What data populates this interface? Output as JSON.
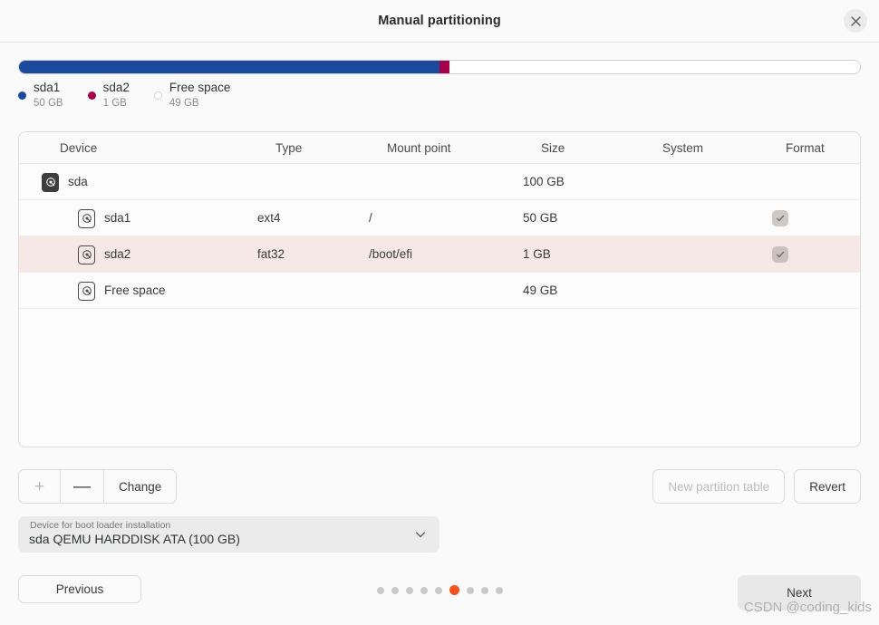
{
  "window": {
    "title": "Manual partitioning",
    "close_icon": "close-icon"
  },
  "usage": {
    "segments": [
      {
        "name": "sda1",
        "size": "50 GB",
        "color": "#1a4a9c",
        "percent": 50.0
      },
      {
        "name": "sda2",
        "size": "1 GB",
        "color": "#a4004b",
        "percent": 1.2
      },
      {
        "name": "Free space",
        "size": "49 GB",
        "color": "#ffffff",
        "percent": 48.8
      }
    ],
    "legend": [
      {
        "label": "sda1",
        "size": "50 GB",
        "color": "#1a4a9c",
        "hollow": false
      },
      {
        "label": "sda2",
        "size": "1 GB",
        "color": "#a4004b",
        "hollow": false
      },
      {
        "label": "Free space",
        "size": "49 GB",
        "color": "#ffffff",
        "hollow": true
      }
    ]
  },
  "table": {
    "columns": [
      "Device",
      "Type",
      "Mount point",
      "Size",
      "System",
      "Format"
    ],
    "rows": [
      {
        "device": "sda",
        "type": "",
        "mount_point": "",
        "size": "100 GB",
        "system": "",
        "format": false,
        "indent": 0,
        "icon": "disk-icon-filled",
        "selected": false
      },
      {
        "device": "sda1",
        "type": "ext4",
        "mount_point": "/",
        "size": "50 GB",
        "system": "",
        "format": true,
        "indent": 1,
        "icon": "partition-icon-outline",
        "selected": false
      },
      {
        "device": "sda2",
        "type": "fat32",
        "mount_point": "/boot/efi",
        "size": "1 GB",
        "system": "",
        "format": true,
        "indent": 1,
        "icon": "partition-icon-outline",
        "selected": true
      },
      {
        "device": "Free space",
        "type": "",
        "mount_point": "",
        "size": "49 GB",
        "system": "",
        "format": false,
        "indent": 1,
        "icon": "partition-icon-outline",
        "selected": false
      }
    ]
  },
  "toolbar": {
    "add_label": "+",
    "remove_label": "—",
    "change_label": "Change",
    "new_partition_table_label": "New partition table",
    "revert_label": "Revert"
  },
  "bootloader": {
    "label": "Device for boot loader installation",
    "value": "sda QEMU HARDDISK ATA (100 GB)",
    "arrow_icon": "chevron-down-icon"
  },
  "footer": {
    "previous_label": "Previous",
    "next_label": "Next",
    "dots_total": 9,
    "dots_active_index": 5,
    "active_dot_color": "#f4511e"
  },
  "watermark": {
    "text": "CSDN @coding_kids"
  }
}
